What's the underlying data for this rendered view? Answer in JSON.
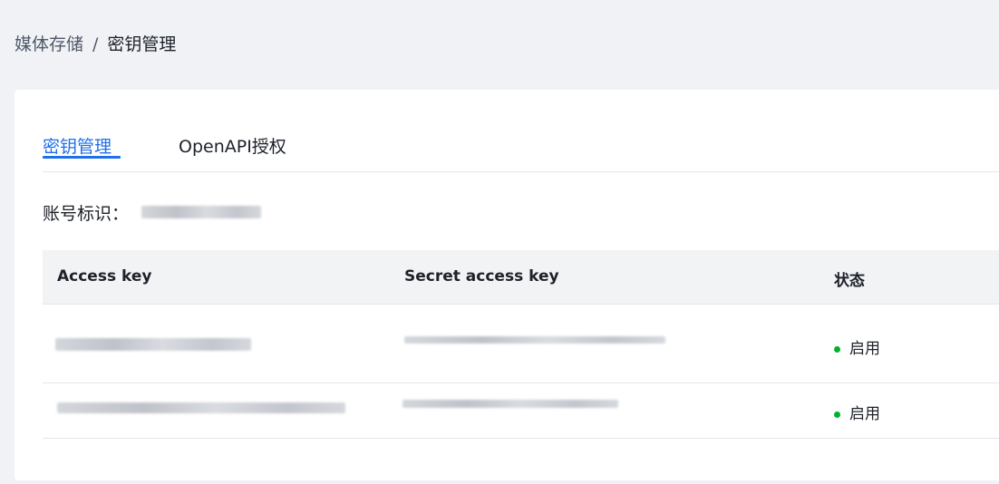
{
  "breadcrumb": {
    "parent": "媒体存储",
    "separator": "/",
    "current": "密钥管理"
  },
  "tabs": [
    {
      "label": "密钥管理",
      "active": true
    },
    {
      "label": "OpenAPI授权",
      "active": false
    }
  ],
  "account": {
    "label": "账号标识："
  },
  "table": {
    "columns": [
      "Access key",
      "Secret access key",
      "状态"
    ],
    "rows": [
      {
        "status": "启用"
      },
      {
        "status": "启用"
      }
    ]
  },
  "colors": {
    "accent": "#1f6fe8",
    "status_enabled": "#00b42a",
    "page_bg": "#f0f2f5"
  }
}
